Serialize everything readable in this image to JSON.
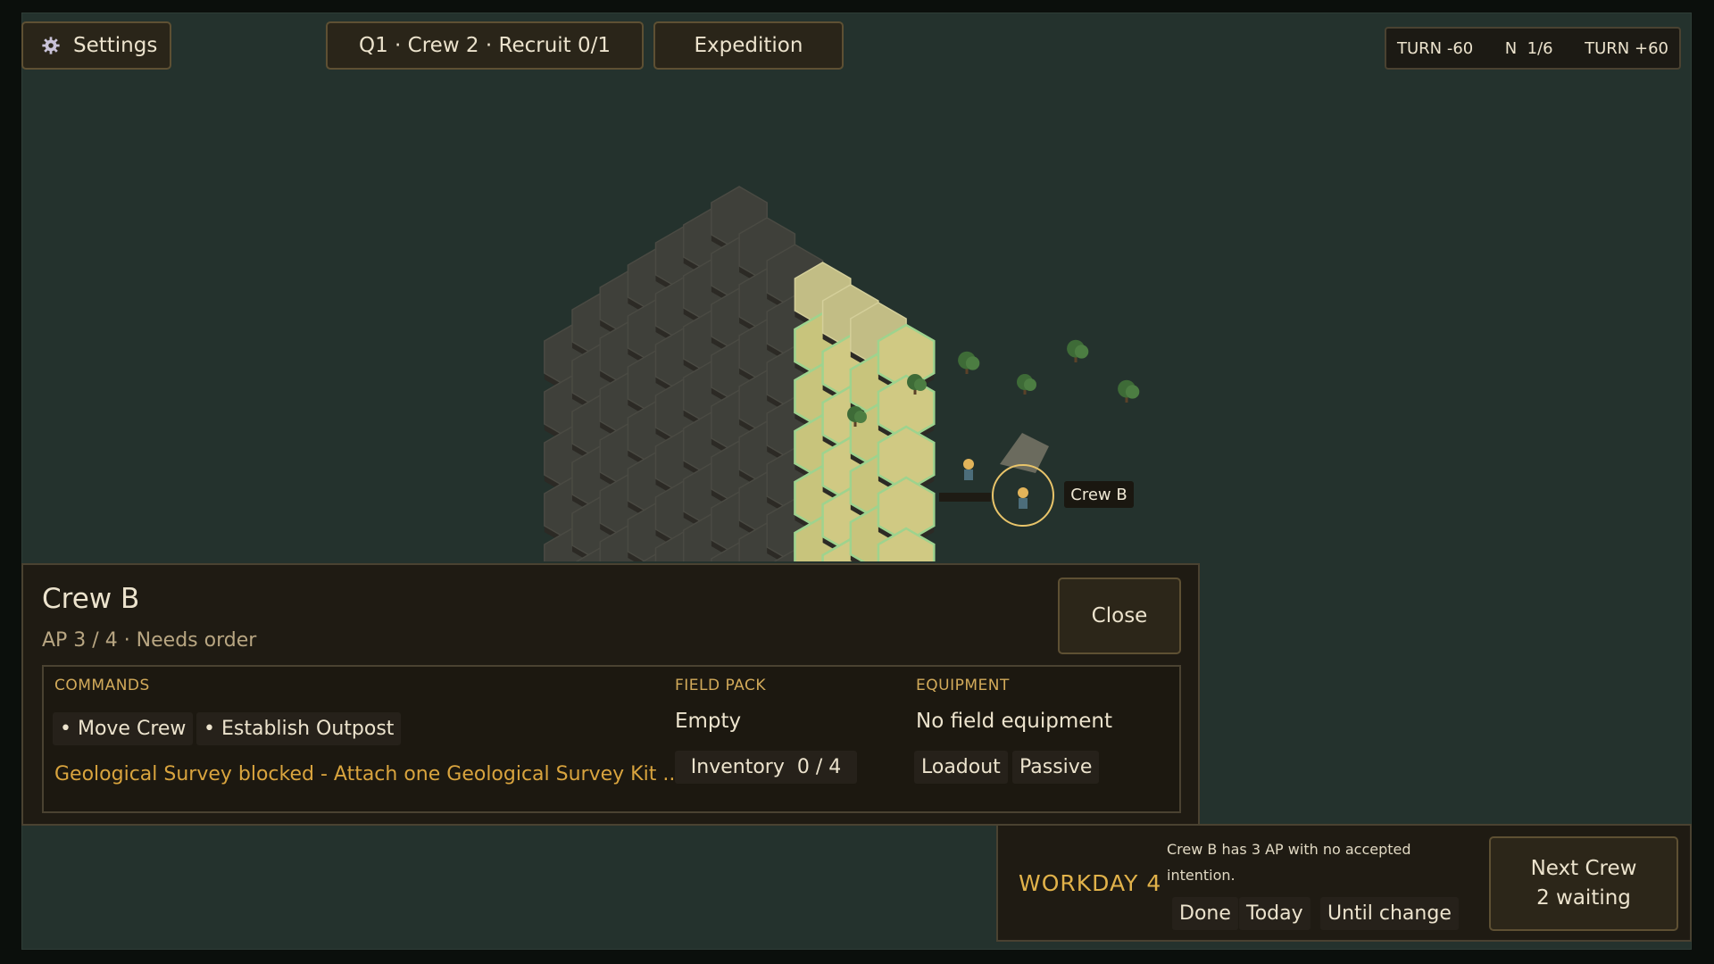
{
  "header": {
    "settings_label": "Settings",
    "status_pill": "Q1 · Crew 2 · Recruit 0/1",
    "expedition_label": "Expedition"
  },
  "turn_bar": {
    "back": "TURN -60",
    "north": "N  1/6",
    "forward": "TURN +60"
  },
  "map": {
    "selected_crew_label": "Crew B"
  },
  "crew_panel": {
    "name": "Crew B",
    "subtitle": "AP 3 / 4 · Needs order",
    "close_label": "Close",
    "commands_label": "COMMANDS",
    "commands": [
      "• Move Crew",
      "• Establish Outpost"
    ],
    "blocked_message": "Geological Survey blocked - Attach one Geological Survey Kit ...",
    "field_pack_label": "FIELD PACK",
    "field_pack_value": "Empty",
    "inventory_label": "Inventory  0 / 4",
    "equipment_label": "EQUIPMENT",
    "equipment_value": "No field equipment",
    "loadout_label": "Loadout",
    "passive_label": "Passive"
  },
  "workday": {
    "label": "WORKDAY 4",
    "message": "Crew B has 3 AP with no accepted intention.",
    "done_label": "Done",
    "today_label": "Today",
    "until_change_label": "Until change",
    "next_crew_label": "Next Crew",
    "next_crew_waiting": "2 waiting"
  },
  "colors": {
    "background": "#24322d",
    "panel": "#1f1b13",
    "accent": "#d9a43e",
    "grass": "#c8c47c",
    "fog": "#3f403a"
  }
}
